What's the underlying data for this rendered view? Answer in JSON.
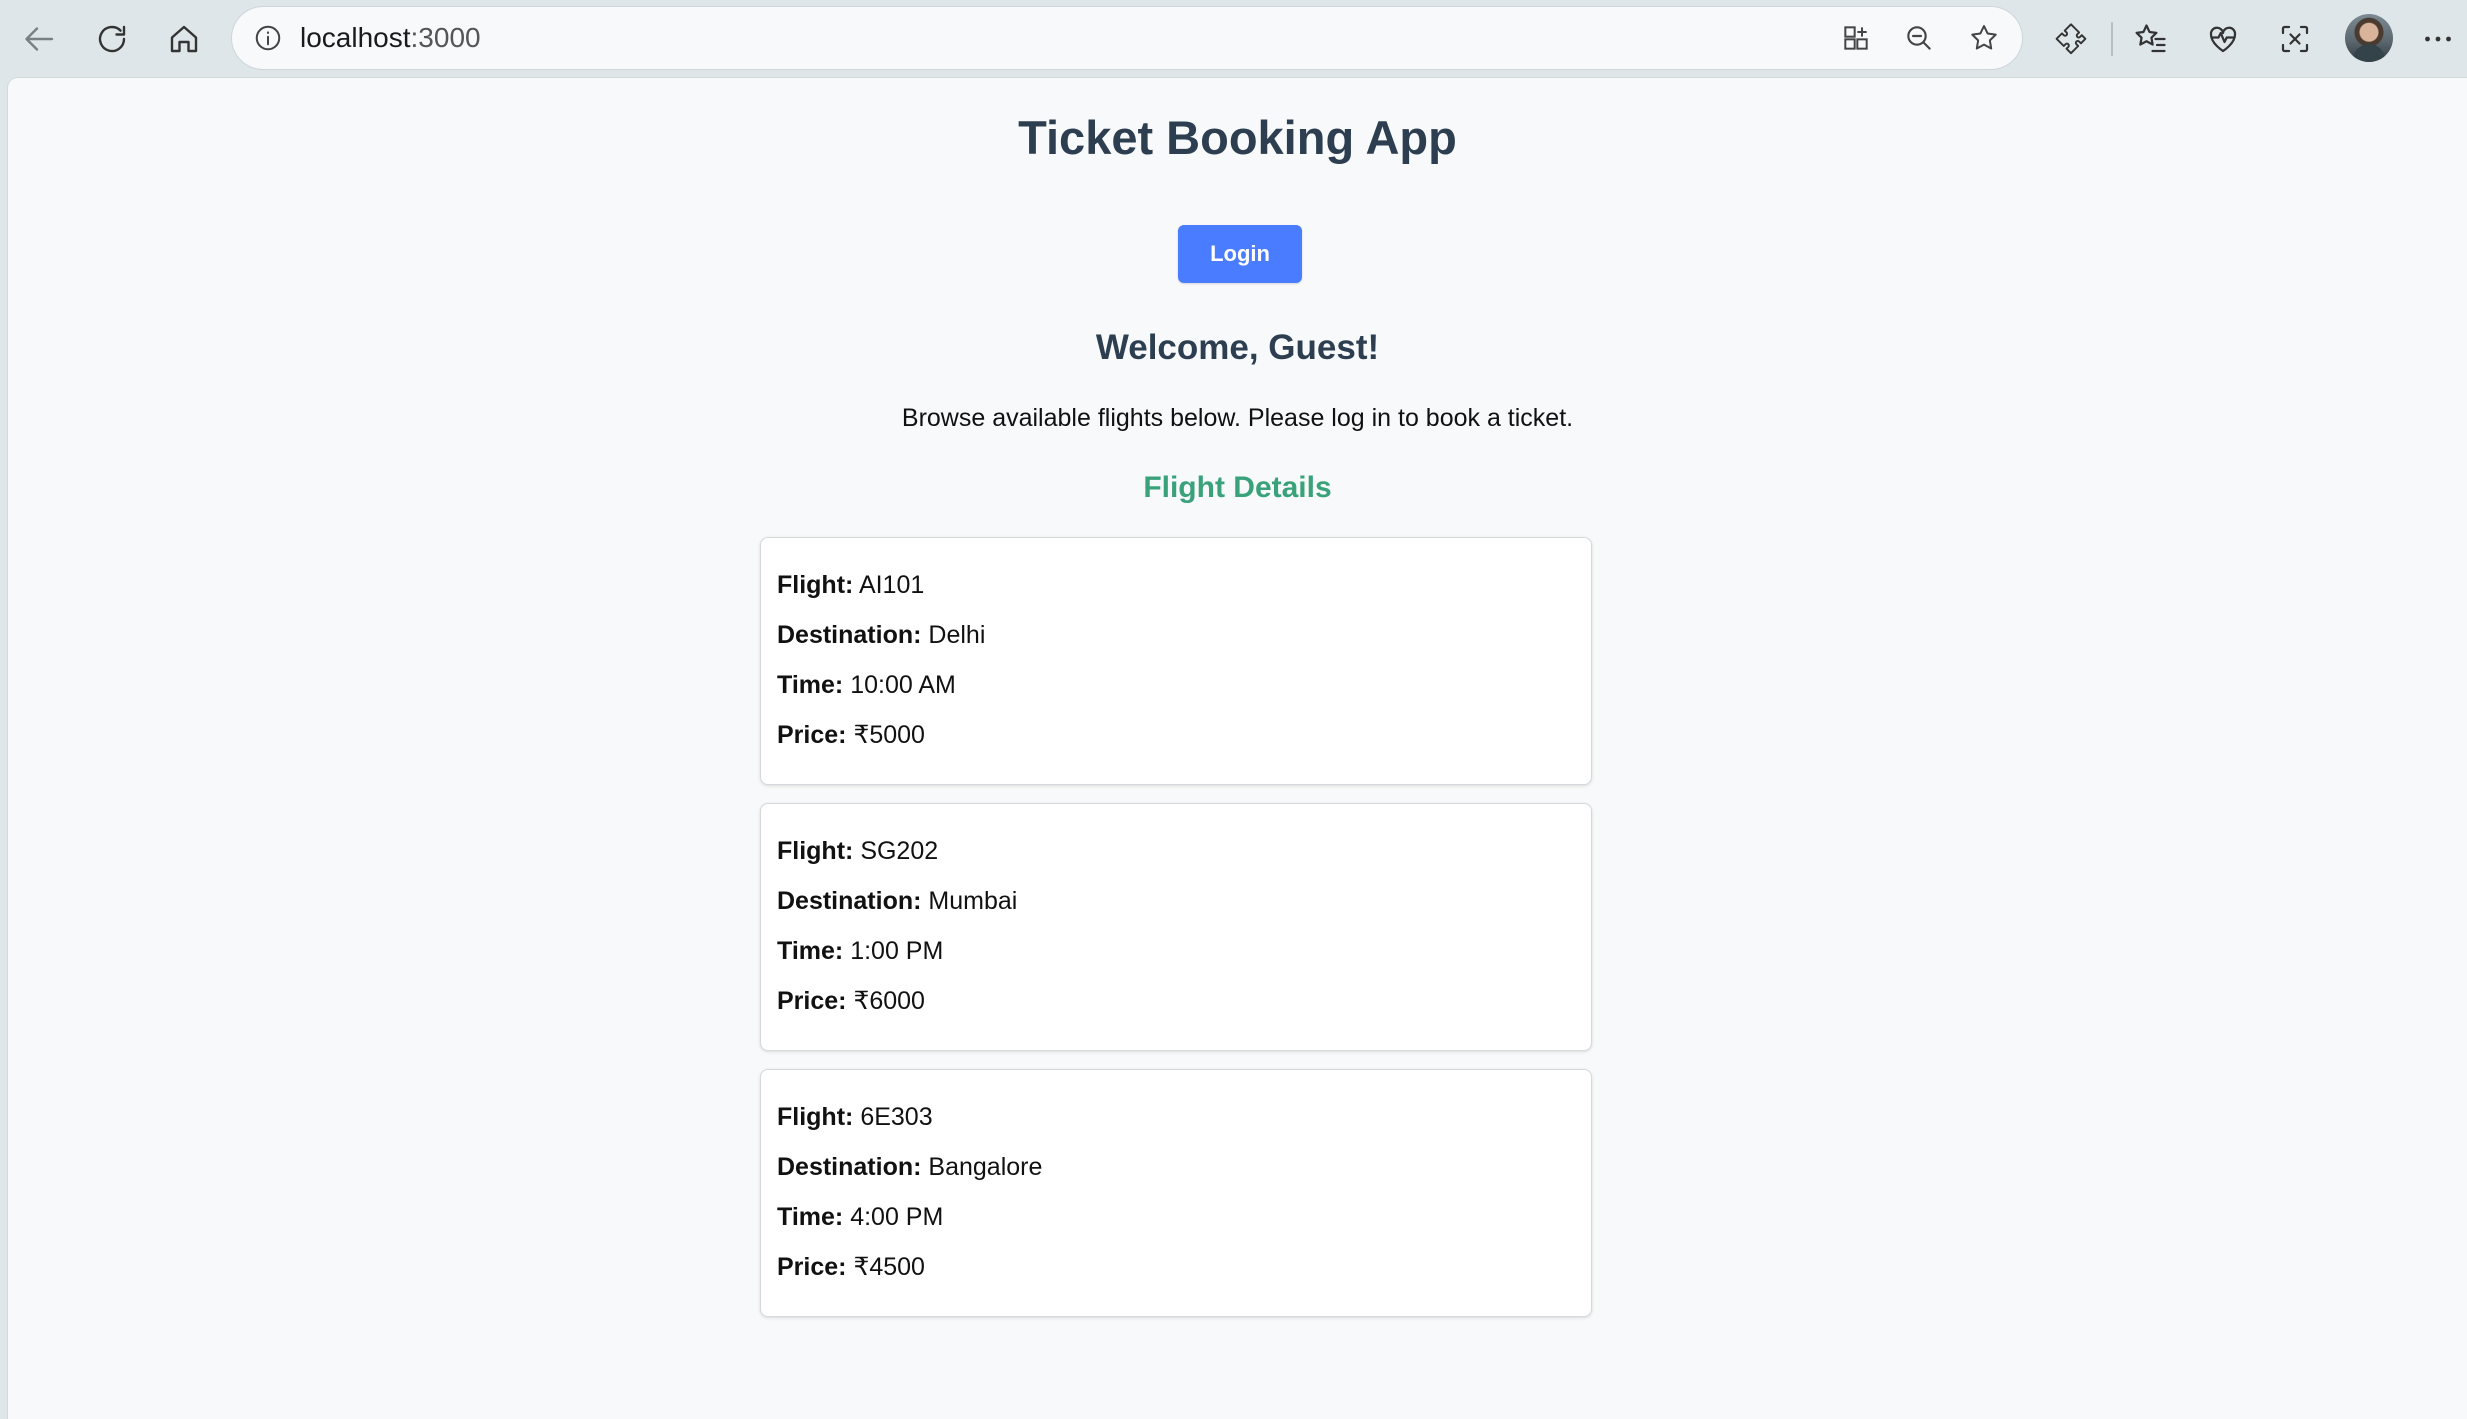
{
  "browser": {
    "url_host": "localhost",
    "url_port": ":3000",
    "icons": [
      "back-icon",
      "refresh-icon",
      "home-icon",
      "info-icon",
      "app-available-icon",
      "zoom-out-icon",
      "favorite-star-icon",
      "extensions-icon",
      "favorites-icon",
      "browser-essentials-icon",
      "screenshot-icon",
      "profile-avatar",
      "more-icon"
    ]
  },
  "page": {
    "title": "Ticket Booking App",
    "login_label": "Login",
    "welcome": "Welcome, Guest!",
    "browse_text": "Browse available flights below. Please log in to book a ticket.",
    "section_title": "Flight Details"
  },
  "labels": {
    "flight": "Flight:",
    "destination": "Destination:",
    "time": "Time:",
    "price": "Price:"
  },
  "flights": [
    {
      "flight": "AI101",
      "destination": "Delhi",
      "time": "10:00 AM",
      "price": "₹5000"
    },
    {
      "flight": "SG202",
      "destination": "Mumbai",
      "time": "1:00 PM",
      "price": "₹6000"
    },
    {
      "flight": "6E303",
      "destination": "Bangalore",
      "time": "4:00 PM",
      "price": "₹4500"
    }
  ],
  "colors": {
    "accent_button": "#4a7cff",
    "heading": "#2c3e50",
    "section_title": "#3aa27a"
  }
}
